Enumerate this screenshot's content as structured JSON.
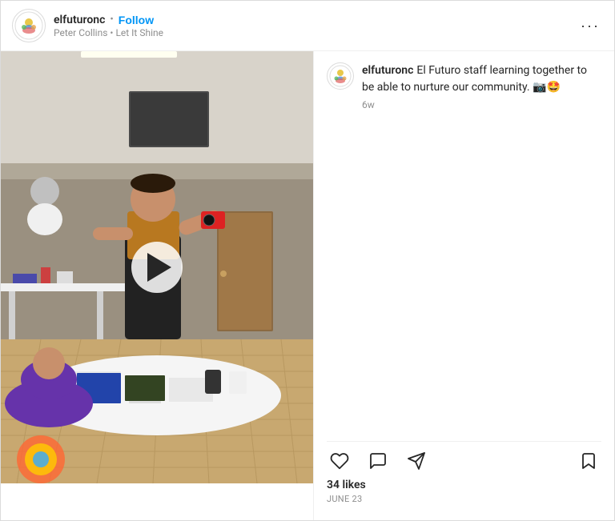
{
  "header": {
    "username": "elfuturonc",
    "follow_label": "Follow",
    "dot": "•",
    "subtitle_user": "Peter Collins",
    "subtitle_song": "Let It Shine",
    "more_icon": "···"
  },
  "comment": {
    "username": "elfuturonc",
    "text": "El Futuro staff learning together to be able to nurture our community. 📷🤩",
    "time": "6w"
  },
  "actions": {
    "likes": "34 likes",
    "date": "JUNE 23"
  }
}
